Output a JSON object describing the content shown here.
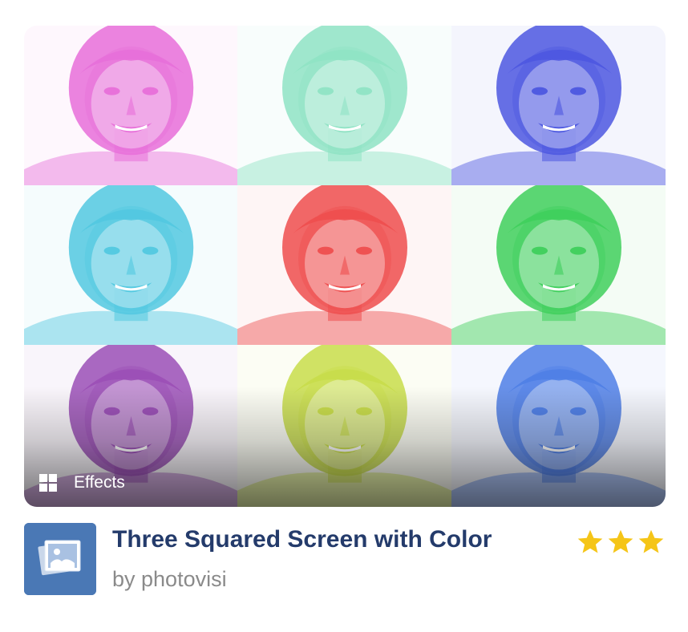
{
  "preview": {
    "category_label": "Effects",
    "category_icon": "grid-icon",
    "tile_colors": [
      "#e76fd9",
      "#8fe3c4",
      "#4c57e0",
      "#52c8e0",
      "#ee4e4e",
      "#3fcf5c",
      "#9b4fb6",
      "#c8dd4a",
      "#4f7fe6"
    ]
  },
  "app": {
    "icon": "photos-icon",
    "title": "Three Squared Screen with Color",
    "author": "by photovisi",
    "rating": 3,
    "star_color": "#f5c518"
  }
}
